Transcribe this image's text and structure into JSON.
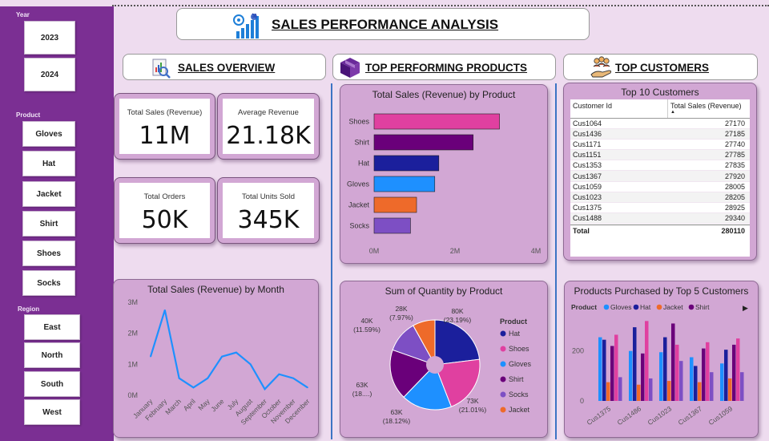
{
  "colors": {
    "sidebar": "#7b2f93",
    "gloves": "#1e90ff",
    "hat": "#1b1f9c",
    "jacket": "#ee6a2a",
    "shirt": "#6a007a",
    "shoes": "#e040a0",
    "socks": "#7d4fc4",
    "line": "#1e90ff"
  },
  "sidebar": {
    "year_label": "Year",
    "years": [
      "2023",
      "2024"
    ],
    "product_label": "Product",
    "products": [
      "Gloves",
      "Hat",
      "Jacket",
      "Shirt",
      "Shoes",
      "Socks"
    ],
    "region_label": "Region",
    "regions": [
      "East",
      "North",
      "South",
      "West"
    ]
  },
  "header": {
    "title": "SALES PERFORMANCE ANALYSIS",
    "icon": "growth-chart-icon"
  },
  "sections": {
    "overview": "SALES OVERVIEW",
    "products": "TOP PERFORMING PRODUCTS",
    "customers": "TOP CUSTOMERS"
  },
  "kpis": {
    "total_sales_label": "Total Sales (Revenue)",
    "total_sales_value": "11M",
    "avg_revenue_label": "Average Revenue",
    "avg_revenue_value": "21.18K",
    "total_orders_label": "Total Orders",
    "total_orders_value": "50K",
    "units_sold_label": "Total Units Sold",
    "units_sold_value": "345K"
  },
  "chart_data": [
    {
      "type": "bar",
      "orientation": "horizontal",
      "title": "Total Sales (Revenue) by Product",
      "categories": [
        "Shoes",
        "Shirt",
        "Hat",
        "Gloves",
        "Jacket",
        "Socks"
      ],
      "values": [
        3100000,
        2450000,
        1600000,
        1500000,
        1050000,
        900000
      ],
      "xlim": [
        0,
        4000000
      ],
      "xticks": [
        "0M",
        "2M",
        "4M"
      ]
    },
    {
      "type": "pie",
      "title": "Sum of Quantity by Product",
      "legend_title": "Product",
      "slices": [
        {
          "label": "Hat",
          "value": 80,
          "text": "80K",
          "pct": "(23.19%)"
        },
        {
          "label": "Shoes",
          "value": 73,
          "text": "73K",
          "pct": "(21.01%)"
        },
        {
          "label": "Gloves",
          "value": 63,
          "text": "63K",
          "pct": "(18.12%)"
        },
        {
          "label": "Shirt",
          "value": 63,
          "text": "63K",
          "pct": "(18....)"
        },
        {
          "label": "Socks",
          "value": 40,
          "text": "40K",
          "pct": "(11.59%)"
        },
        {
          "label": "Jacket",
          "value": 28,
          "text": "28K",
          "pct": "(7.97%)"
        }
      ],
      "legend": [
        "Hat",
        "Shoes",
        "Gloves",
        "Shirt",
        "Socks",
        "Jacket"
      ],
      "legend_position": "right"
    },
    {
      "type": "line",
      "title": "Total Sales (Revenue) by Month",
      "categories": [
        "January",
        "February",
        "March",
        "April",
        "May",
        "June",
        "July",
        "August",
        "September",
        "October",
        "November",
        "December"
      ],
      "values": [
        1250000,
        2750000,
        550000,
        250000,
        550000,
        1250000,
        1380000,
        1000000,
        200000,
        680000,
        550000,
        250000
      ],
      "ylim": [
        0,
        3000000
      ],
      "yticks": [
        "0M",
        "1M",
        "2M",
        "3M"
      ]
    },
    {
      "type": "bar",
      "title": "Products Purchased by Top 5 Customers",
      "legend_title": "Product",
      "categories": [
        "Cus1375",
        "Cus1486",
        "Cus1023",
        "Cus1367",
        "Cus1059"
      ],
      "series": [
        {
          "name": "Gloves",
          "values": [
            255,
            200,
            195,
            175,
            150
          ]
        },
        {
          "name": "Hat",
          "values": [
            245,
            295,
            255,
            140,
            205
          ]
        },
        {
          "name": "Jacket",
          "values": [
            75,
            65,
            80,
            75,
            90
          ]
        },
        {
          "name": "Shirt",
          "values": [
            220,
            190,
            310,
            210,
            225
          ]
        },
        {
          "name": "Shoes",
          "values": [
            265,
            320,
            225,
            235,
            250
          ]
        },
        {
          "name": "Socks",
          "values": [
            95,
            90,
            160,
            115,
            115
          ]
        }
      ],
      "yticks": [
        "0",
        "200"
      ],
      "ylim": [
        0,
        350
      ],
      "legend_position": "top"
    }
  ],
  "customers_table": {
    "title": "Top 10 Customers",
    "col1": "Customer Id",
    "col2": "Total Sales (Revenue)",
    "rows": [
      [
        "Cus1064",
        "27170"
      ],
      [
        "Cus1436",
        "27185"
      ],
      [
        "Cus1171",
        "27740"
      ],
      [
        "Cus1151",
        "27785"
      ],
      [
        "Cus1353",
        "27835"
      ],
      [
        "Cus1367",
        "27920"
      ],
      [
        "Cus1059",
        "28005"
      ],
      [
        "Cus1023",
        "28205"
      ],
      [
        "Cus1375",
        "28925"
      ],
      [
        "Cus1488",
        "29340"
      ]
    ],
    "total_label": "Total",
    "total_value": "280110"
  }
}
